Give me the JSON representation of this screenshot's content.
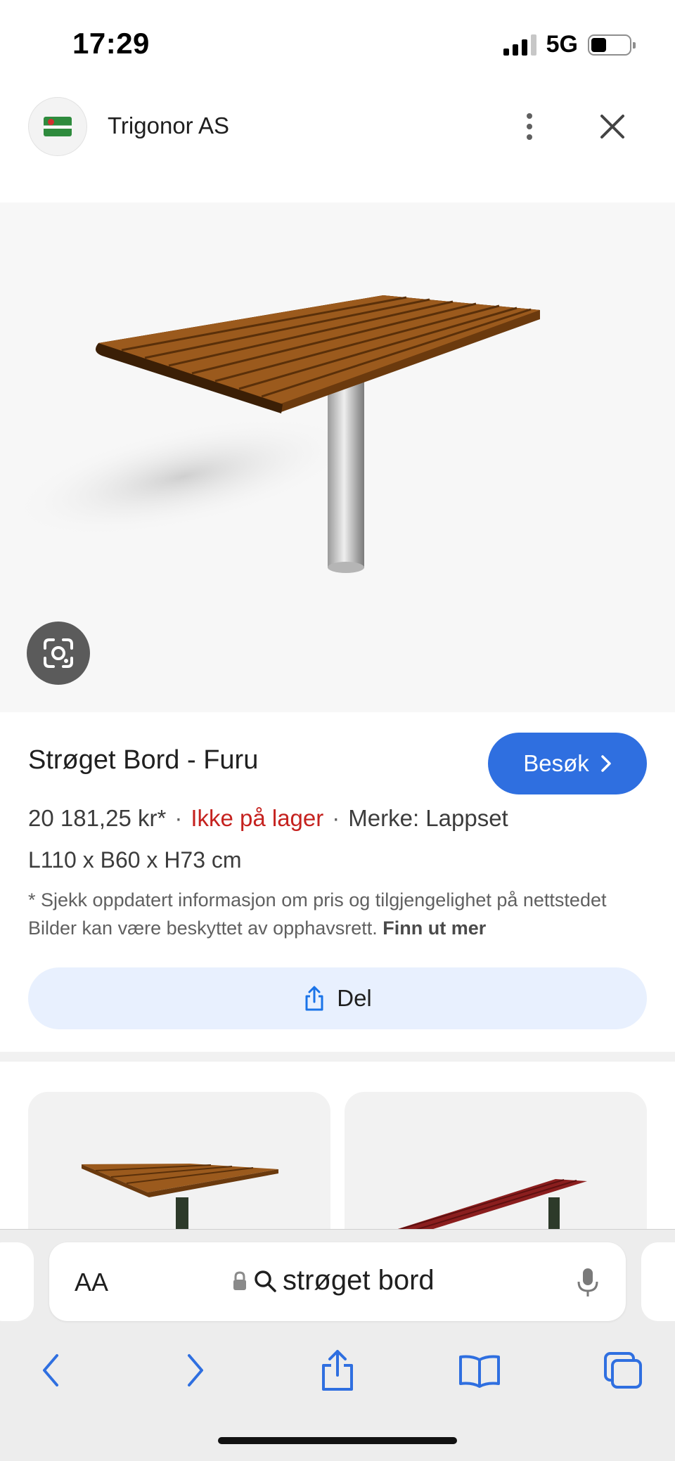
{
  "status_bar": {
    "time": "17:29",
    "network": "5G",
    "battery_level": 0.4
  },
  "header": {
    "site_name": "Trigonor AS",
    "logo_icon": "trigonor-logo-icon",
    "more_icon": "more-vertical-icon",
    "close_icon": "close-icon"
  },
  "hero": {
    "lens_icon": "google-lens-icon"
  },
  "product": {
    "title": "Strøget Bord - Furu",
    "visit_label": "Besøk",
    "price": "20 181,25 kr*",
    "separator": "·",
    "stock": "Ikke på lager",
    "brand": "Merke: Lappset",
    "dimensions": "L110 x B60 x H73 cm",
    "disclaimer": "* Sjekk oppdatert informasjon om pris og tilgjengelighet på nettstedet Bilder kan være beskyttet av opphavsrett.",
    "learn_more": "Finn ut mer",
    "share_label": "Del",
    "colors": {
      "accent": "#2f6fe0",
      "stock_red": "#c5221f",
      "share_bg": "#e8f0fe"
    }
  },
  "browser": {
    "text_size": "AA",
    "url_text": "strøget bord",
    "icons": [
      "back-icon",
      "forward-icon",
      "share-icon",
      "bookmarks-icon",
      "tabs-icon",
      "microphone-icon",
      "lock-icon",
      "search-icon"
    ]
  }
}
